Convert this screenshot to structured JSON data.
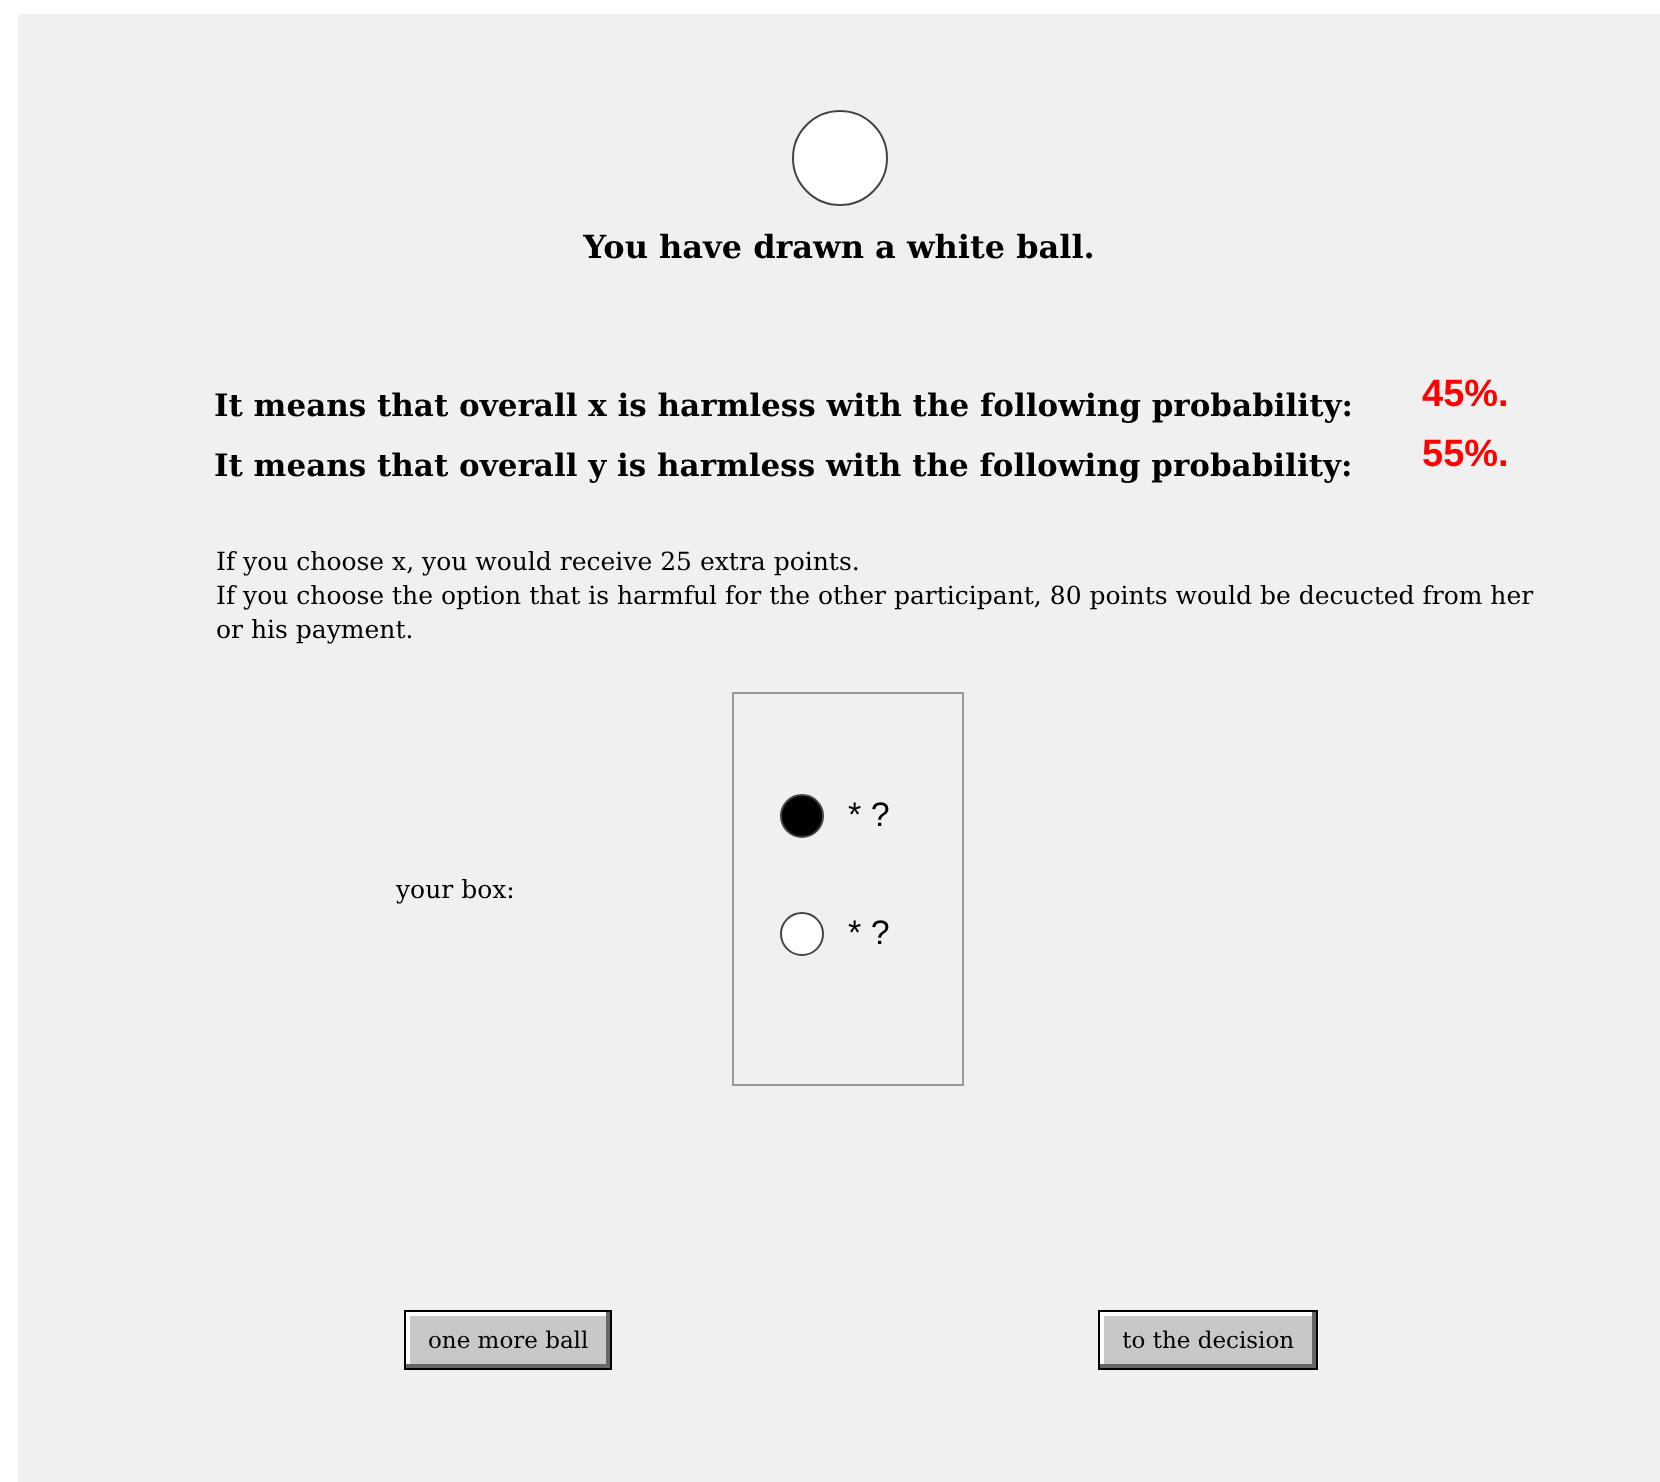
{
  "drawn_ball": {
    "color": "#ffffff"
  },
  "title": "You have drawn a white ball.",
  "probabilities": [
    {
      "label": "It means that overall x is harmless with the following probability:",
      "value": "45%."
    },
    {
      "label": "It means that overall y is harmless with the following probability:",
      "value": "55%."
    }
  ],
  "info": [
    "If you choose x, you would receive 25 extra points.",
    "If you choose the option that is harmful for the other participant, 80 points would be decucted from her or his payment."
  ],
  "box": {
    "label": "your box:",
    "balls": [
      {
        "color": "#000000",
        "count": "* ?"
      },
      {
        "color": "#ffffff",
        "count": "* ?"
      }
    ]
  },
  "buttons": [
    "one more ball",
    "to the decision"
  ]
}
